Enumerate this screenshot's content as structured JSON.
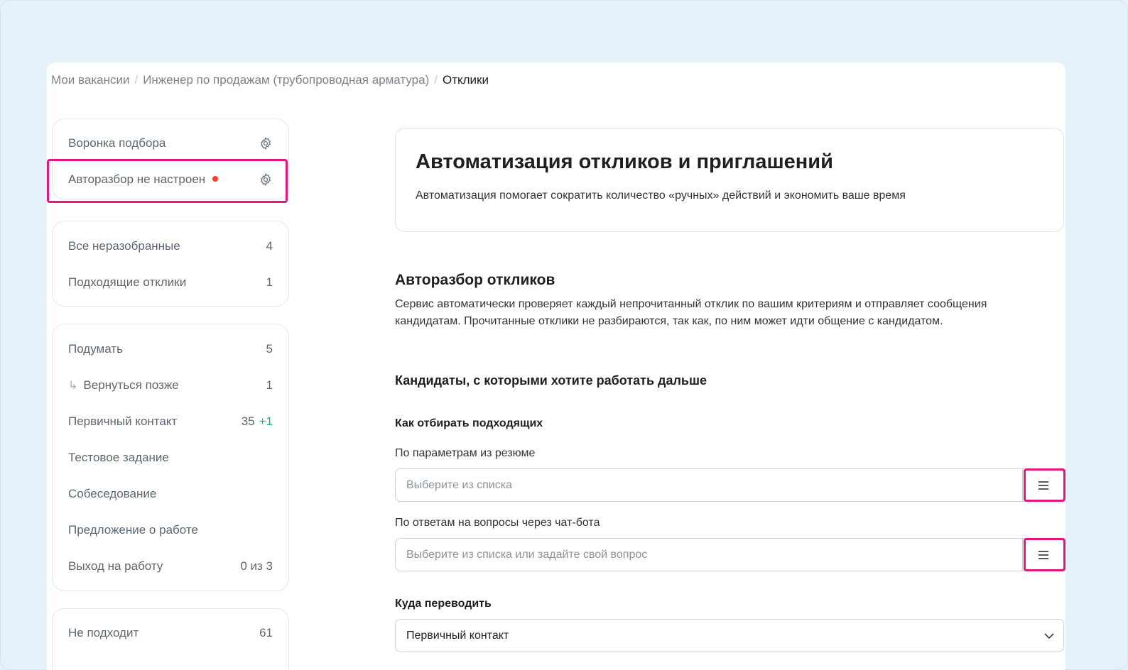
{
  "breadcrumb": {
    "items": [
      "Мои вакансии",
      "Инженер по продажам (трубопроводная арматура)"
    ],
    "separator": "/",
    "current": "Отклики"
  },
  "sidebar": {
    "top_card": {
      "funnel_label": "Воронка подбора",
      "autoparse_label": "Авторазбор не настроен",
      "autoparse_dot_color": "#ff3b30",
      "icon": "gear-icon"
    },
    "unsorted_card": [
      {
        "label": "Все неразобранные",
        "count": "4"
      },
      {
        "label": "Подходящие отклики",
        "count": "1"
      }
    ],
    "stages_card": [
      {
        "label": "Подумать",
        "count": "5"
      },
      {
        "label": "Вернуться позже",
        "count": "1",
        "sub": true
      },
      {
        "label": "Первичный контакт",
        "count": "35",
        "plus": "+1"
      },
      {
        "label": "Тестовое задание",
        "count": ""
      },
      {
        "label": "Собеседование",
        "count": ""
      },
      {
        "label": "Предложение о работе",
        "count": ""
      },
      {
        "label": "Выход на работу",
        "count": "0 из 3"
      }
    ],
    "rejected_card": [
      {
        "label": "Не подходит",
        "count": "61"
      }
    ]
  },
  "main": {
    "hero": {
      "title": "Автоматизация откликов и приглашений",
      "subtitle": "Автоматизация помогает сократить количество «ручных» действий и экономить ваше время"
    },
    "autoparse_title": "Авторазбор откликов",
    "autoparse_desc": "Сервис автоматически проверяет каждый непрочитанный отклик по вашим критериям и отправляет сообщения кандидатам. Прочитанные отклики не разбираются, так как, по ним может идти общение с кандидатом.",
    "candidates_title": "Кандидаты, с которыми хотите работать дальше",
    "how_to_select": "Как отбирать подходящих",
    "resume_params_label": "По параметрам из резюме",
    "resume_params_placeholder": "Выберите из списка",
    "chatbot_label": "По ответам на вопросы через чат-бота",
    "chatbot_placeholder": "Выберите из списка или задайте свой вопрос",
    "move_to_label": "Куда переводить",
    "move_to_value": "Первичный контакт"
  },
  "colors": {
    "highlight": "#e3157f",
    "plus_green": "#0fb86b",
    "background": "#e6f2f9"
  }
}
